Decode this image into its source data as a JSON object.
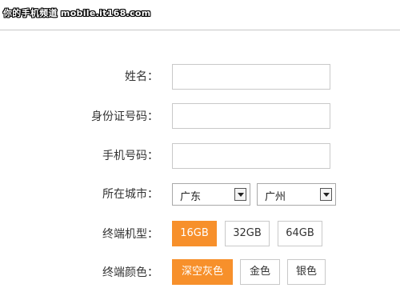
{
  "watermark": "你的手机频道 mobile.it168.com",
  "form": {
    "name": {
      "label": "姓名：",
      "value": ""
    },
    "id_number": {
      "label": "身份证号码：",
      "value": ""
    },
    "phone": {
      "label": "手机号码：",
      "value": ""
    },
    "location": {
      "label": "所在城市：",
      "province": "广东",
      "city": "广州"
    },
    "model": {
      "label": "终端机型：",
      "options": [
        "16GB",
        "32GB",
        "64GB"
      ],
      "selected": "16GB"
    },
    "color": {
      "label": "终端颜色：",
      "options": [
        "深空灰色",
        "金色",
        "银色"
      ],
      "selected": "深空灰色"
    }
  },
  "colors": {
    "accent": "#f7902b",
    "border": "#c9c9c9"
  }
}
